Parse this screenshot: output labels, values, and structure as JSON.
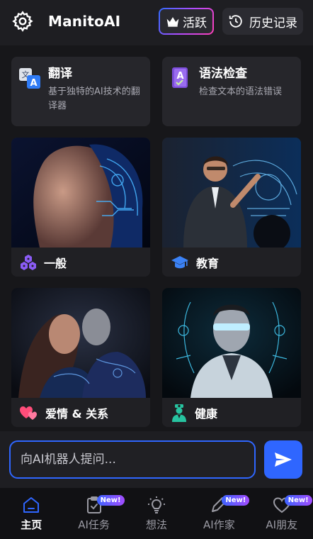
{
  "header": {
    "settings_icon": "gear-icon",
    "title": "ManitoAI",
    "active_badge": {
      "icon": "crown-icon",
      "label": "活跃"
    },
    "history": {
      "icon": "history-icon",
      "label": "历史记录"
    }
  },
  "tools": [
    {
      "icon": "translate-icon",
      "title": "翻译",
      "desc": "基于独特的AI技术的翻译器"
    },
    {
      "icon": "grammar-icon",
      "title": "语法检查",
      "desc": "检查文本的语法错误"
    }
  ],
  "categories": [
    {
      "icon": "hexagons-icon",
      "label": "一般",
      "icon_color": "#8b5cf6"
    },
    {
      "icon": "graduation-cap-icon",
      "label": "教育",
      "icon_color": "#3b82f6"
    },
    {
      "icon": "hearts-icon",
      "label": "爱情 & 关系",
      "icon_color": "#ff4d7a"
    },
    {
      "icon": "doctor-icon",
      "label": "健康",
      "icon_color": "#27c3a0"
    }
  ],
  "input": {
    "placeholder": "向AI机器人提问..."
  },
  "bottom_nav": [
    {
      "icon": "home-icon",
      "label": "主页",
      "active": true,
      "badge": ""
    },
    {
      "icon": "task-clipboard-icon",
      "label": "AI任务",
      "active": false,
      "badge": "New!"
    },
    {
      "icon": "lightbulb-icon",
      "label": "想法",
      "active": false,
      "badge": ""
    },
    {
      "icon": "pen-icon",
      "label": "AI作家",
      "active": false,
      "badge": "New!"
    },
    {
      "icon": "heart-icon",
      "label": "AI朋友",
      "active": false,
      "badge": "New!"
    }
  ],
  "colors": {
    "accent": "#2f66ff",
    "background": "#1e1e22",
    "card": "#26262b"
  }
}
